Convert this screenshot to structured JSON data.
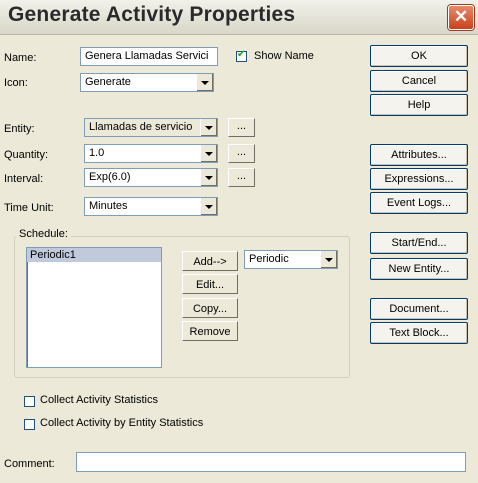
{
  "dialog": {
    "title": "Generate Activity Properties",
    "close_icon": "close-icon"
  },
  "form": {
    "name_label": "Name:",
    "name_value": "Genera Llamadas Servici",
    "show_name_label": "Show Name",
    "show_name_checked": true,
    "icon_label": "Icon:",
    "icon_value": "Generate",
    "entity_label": "Entity:",
    "entity_value": "Llamadas de servicio",
    "quantity_label": "Quantity:",
    "quantity_value": "1.0",
    "interval_label": "Interval:",
    "interval_value": "Exp(6.0)",
    "time_unit_label": "Time Unit:",
    "time_unit_value": "Minutes",
    "browse_label": "..."
  },
  "schedule": {
    "group_label": "Schedule:",
    "items": [
      "Periodic1"
    ],
    "add_label": "Add-->",
    "edit_label": "Edit...",
    "copy_label": "Copy...",
    "remove_label": "Remove",
    "type_value": "Periodic"
  },
  "options": {
    "collect_activity_stats_label": "Collect Activity Statistics",
    "collect_activity_stats_checked": false,
    "collect_by_entity_label": "Collect Activity by Entity Statistics",
    "collect_by_entity_checked": false
  },
  "comment": {
    "label": "Comment:",
    "value": ""
  },
  "buttons": {
    "ok": "OK",
    "cancel": "Cancel",
    "help": "Help",
    "attributes": "Attributes...",
    "expressions": "Expressions...",
    "event_logs": "Event Logs...",
    "start_end": "Start/End...",
    "new_entity": "New Entity...",
    "document": "Document...",
    "text_block": "Text Block..."
  }
}
